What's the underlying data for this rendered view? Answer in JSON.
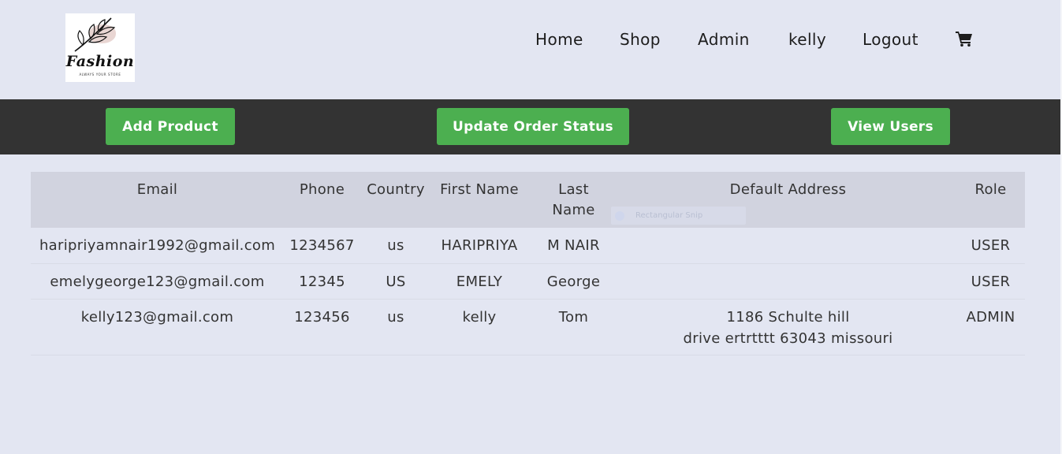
{
  "brand": {
    "logo_word": "Fashion",
    "logo_tagline": "ALWAYS YOUR STORE"
  },
  "nav": {
    "items": [
      {
        "label": "Home"
      },
      {
        "label": "Shop"
      },
      {
        "label": "Admin"
      },
      {
        "label": "kelly"
      },
      {
        "label": "Logout"
      }
    ],
    "cart_icon": "shopping-cart-icon"
  },
  "admin_bar": {
    "buttons": [
      {
        "label": "Add Product"
      },
      {
        "label": "Update Order Status"
      },
      {
        "label": "View Users"
      }
    ],
    "button_color": "#4caf50",
    "bar_color": "#333333"
  },
  "users_table": {
    "columns": [
      "Email",
      "Phone",
      "Country",
      "First Name",
      "Last Name",
      "Default Address",
      "Role"
    ],
    "rows": [
      {
        "email": "haripriyamnair1992@gmail.com",
        "phone": "1234567",
        "country": "us",
        "first_name": "HARIPRIYA",
        "last_name": "M NAIR",
        "address": "",
        "role": "USER"
      },
      {
        "email": "emelygeorge123@gmail.com",
        "phone": "12345",
        "country": "US",
        "first_name": "EMELY",
        "last_name": "George",
        "address": "",
        "role": "USER"
      },
      {
        "email": "kelly123@gmail.com",
        "phone": "123456",
        "country": "us",
        "first_name": "kelly",
        "last_name": "Tom",
        "address": "1186 Schulte hill\ndrive  ertrtttt 63043 missouri",
        "role": "ADMIN"
      }
    ]
  },
  "overlay": {
    "snip_label": "Rectangular Snip"
  }
}
